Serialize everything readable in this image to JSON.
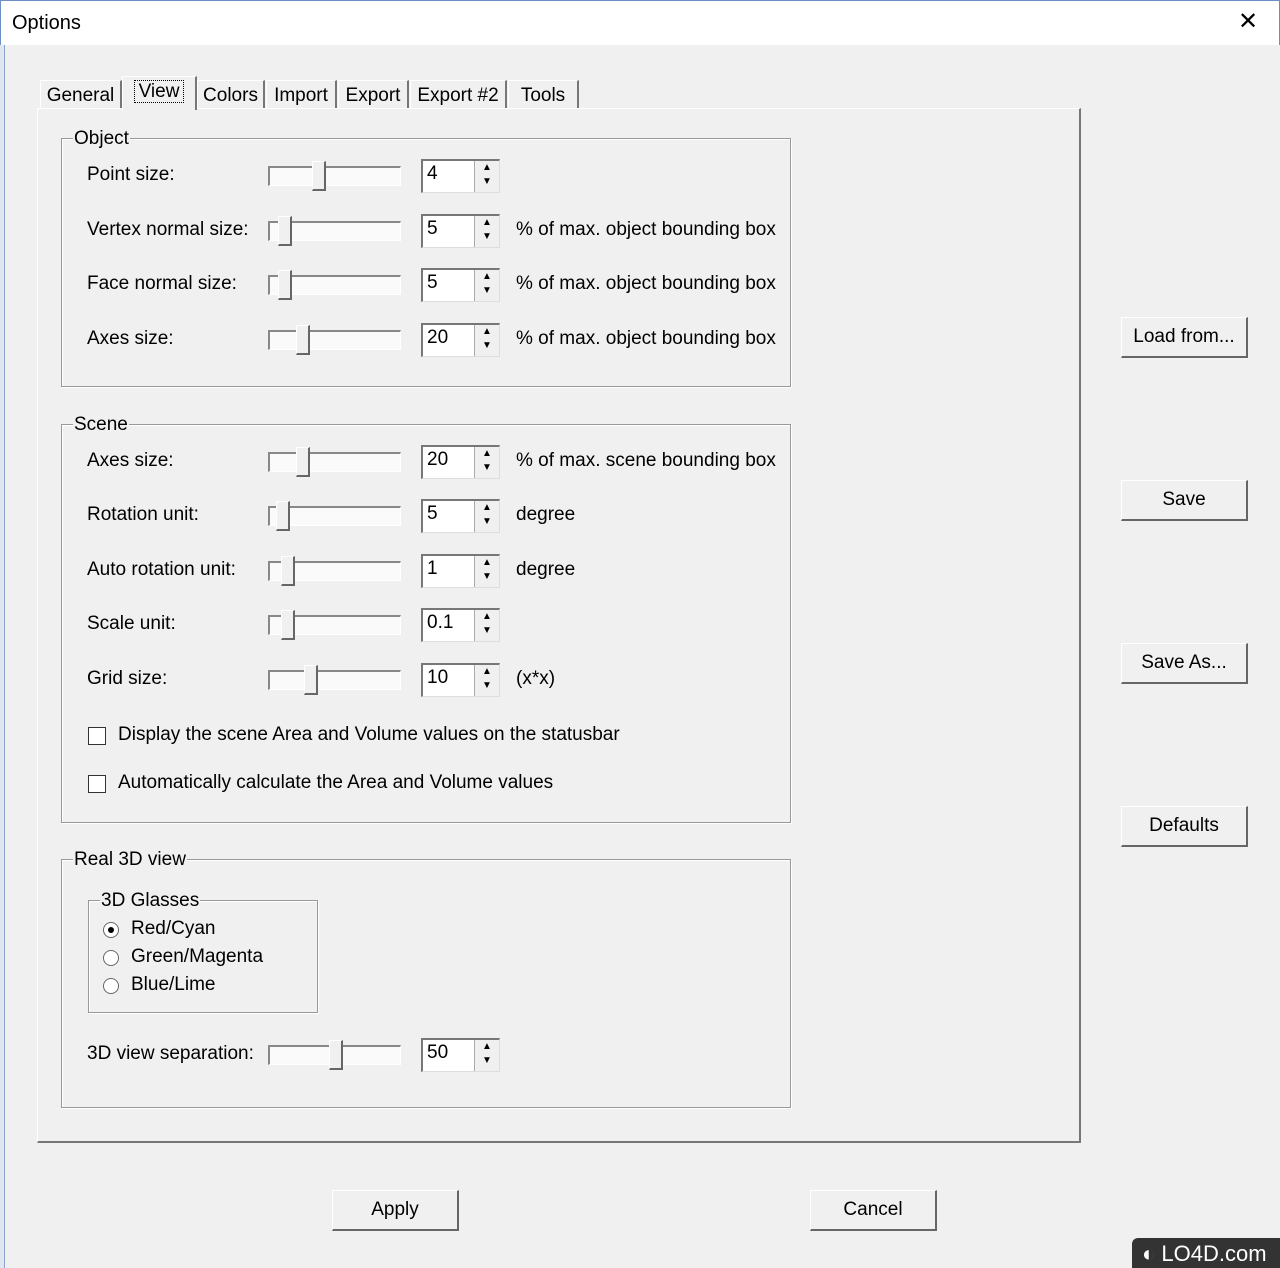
{
  "window": {
    "title": "Options",
    "close_icon": "close-icon"
  },
  "tabs": [
    {
      "label": "General",
      "selected": false
    },
    {
      "label": "View",
      "selected": true
    },
    {
      "label": "Colors",
      "selected": false
    },
    {
      "label": "Import",
      "selected": false
    },
    {
      "label": "Export",
      "selected": false
    },
    {
      "label": "Export #2",
      "selected": false
    },
    {
      "label": "Tools",
      "selected": false
    }
  ],
  "object": {
    "title": "Object",
    "rows": [
      {
        "label": "Point size:",
        "value": "4",
        "slider": 0.36,
        "suffix": ""
      },
      {
        "label": "Vertex normal size:",
        "value": "5",
        "slider": 0.07,
        "suffix": "% of max. object bounding box"
      },
      {
        "label": "Face normal size:",
        "value": "5",
        "slider": 0.07,
        "suffix": "% of max. object bounding box"
      },
      {
        "label": "Axes size:",
        "value": "20",
        "slider": 0.22,
        "suffix": "% of max. object bounding box"
      }
    ]
  },
  "scene": {
    "title": "Scene",
    "rows": [
      {
        "label": "Axes size:",
        "value": "20",
        "slider": 0.22,
        "suffix": "% of max. scene bounding box"
      },
      {
        "label": "Rotation unit:",
        "value": "5",
        "slider": 0.05,
        "suffix": "degree"
      },
      {
        "label": "Auto rotation unit:",
        "value": "1",
        "slider": 0.09,
        "suffix": "degree"
      },
      {
        "label": "Scale unit:",
        "value": "0.1",
        "slider": 0.09,
        "suffix": ""
      },
      {
        "label": "Grid size:",
        "value": "10",
        "slider": 0.29,
        "suffix": "(x*x)"
      }
    ],
    "checkboxes": [
      {
        "label": "Display the scene Area and Volume values on the statusbar",
        "checked": false
      },
      {
        "label": "Automatically calculate the Area and Volume values",
        "checked": false
      }
    ]
  },
  "real3d": {
    "title": "Real 3D view",
    "glasses_title": "3D Glasses",
    "glasses": [
      {
        "label": "Red/Cyan",
        "selected": true
      },
      {
        "label": "Green/Magenta",
        "selected": false
      },
      {
        "label": "Blue/Lime",
        "selected": false
      }
    ],
    "separation": {
      "label": "3D view separation:",
      "value": "50",
      "slider": 0.5
    }
  },
  "side_buttons": [
    "Load from...",
    "Save",
    "Save As...",
    "Defaults"
  ],
  "footer": {
    "apply": "Apply",
    "cancel": "Cancel"
  },
  "watermark": "LO4D.com"
}
